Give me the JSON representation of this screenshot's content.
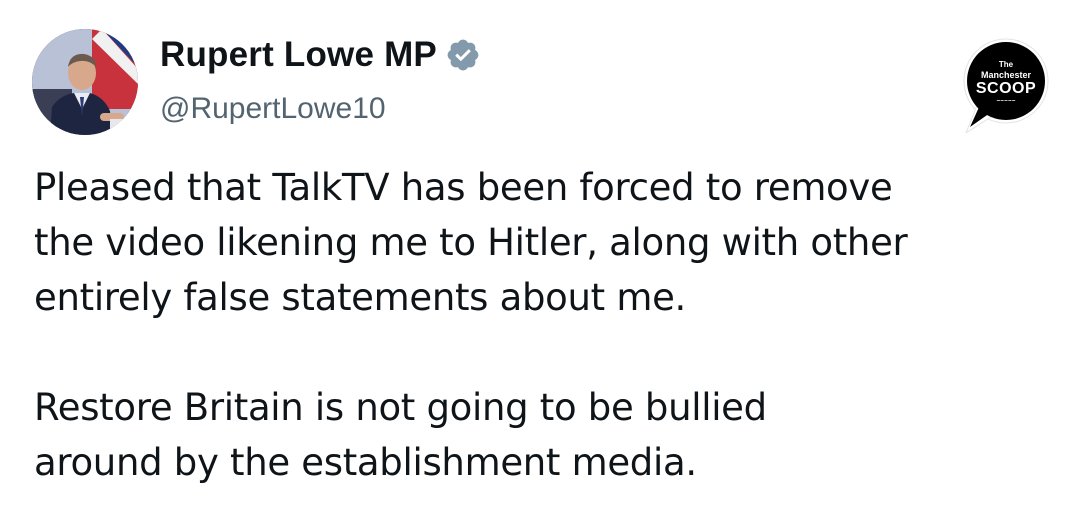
{
  "tweet": {
    "author": {
      "display_name": "Rupert Lowe MP",
      "handle": "@RupertLowe10",
      "verified_icon": "verified-badge-icon",
      "verified_color": "#829aab"
    },
    "body": {
      "paragraph_1": [
        "Pleased that TalkTV has been forced to remove",
        "the video likening me to Hitler, along with other",
        "entirely false statements about me."
      ],
      "paragraph_2": [
        "Restore Britain is not going to be bullied",
        "around by the establishment media."
      ]
    }
  },
  "watermark": {
    "line_1": "The",
    "line_2": "Manchester",
    "line_3": "SCOOP",
    "bubble_color": "#000000"
  },
  "colors": {
    "text": "#0f1419",
    "secondary_text": "#536471",
    "background": "#ffffff"
  }
}
